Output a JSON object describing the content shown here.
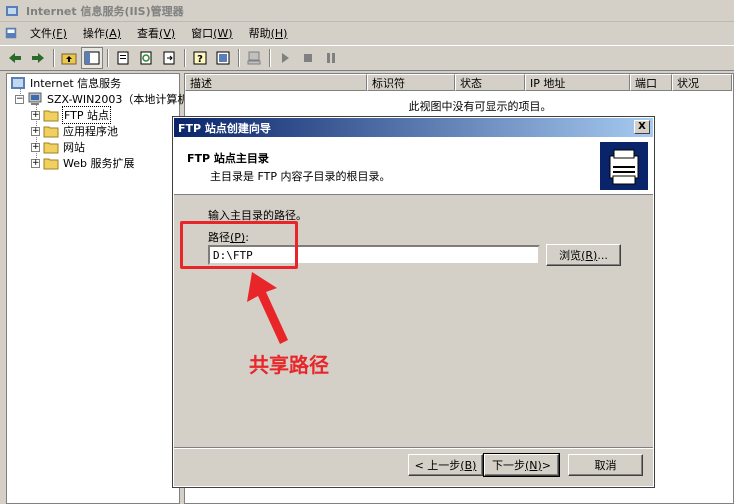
{
  "window": {
    "title": "Internet 信息服务(IIS)管理器"
  },
  "menu": [
    {
      "label": "文件",
      "key": "(F)"
    },
    {
      "label": "操作",
      "key": "(A)"
    },
    {
      "label": "查看",
      "key": "(V)"
    },
    {
      "label": "窗口",
      "key": "(W)"
    },
    {
      "label": "帮助",
      "key": "(H)"
    }
  ],
  "toolbar_icons": [
    "back-icon",
    "forward-icon",
    "up-folder-icon",
    "show-tree-icon",
    "properties-icon",
    "refresh-icon",
    "export-icon",
    "help-icon",
    "console-icon",
    "computer-icon",
    "play-icon",
    "stop-icon",
    "pause-icon"
  ],
  "tree": {
    "root": "Internet 信息服务",
    "server": "SZX-WIN2003（本地计算机",
    "children": [
      "FTP 站点",
      "应用程序池",
      "网站",
      "Web 服务扩展"
    ]
  },
  "list": {
    "columns": [
      "描述",
      "标识符",
      "状态",
      "IP 地址",
      "端口",
      "状况"
    ],
    "empty_message": "此视图中没有可显示的项目。"
  },
  "dialog": {
    "title": "FTP 站点创建向导",
    "heading": "FTP 站点主目录",
    "subheading": "主目录是 FTP 内容子目录的根目录。",
    "instruction": "输入主目录的路径。",
    "path_label": "路径",
    "path_key": "(P)",
    "path_colon": ":",
    "path_value": "D:\\FTP",
    "browse_label": "浏览",
    "browse_key": "(R)",
    "browse_suffix": "...",
    "back_label": "< 上一步",
    "back_key": "(B)",
    "next_label": "下一步",
    "next_key": "(N)",
    "next_suffix": " >",
    "cancel_label": "取消",
    "close_glyph": "X"
  },
  "annotation": {
    "text": "共享路径",
    "color": "#e8262a"
  }
}
